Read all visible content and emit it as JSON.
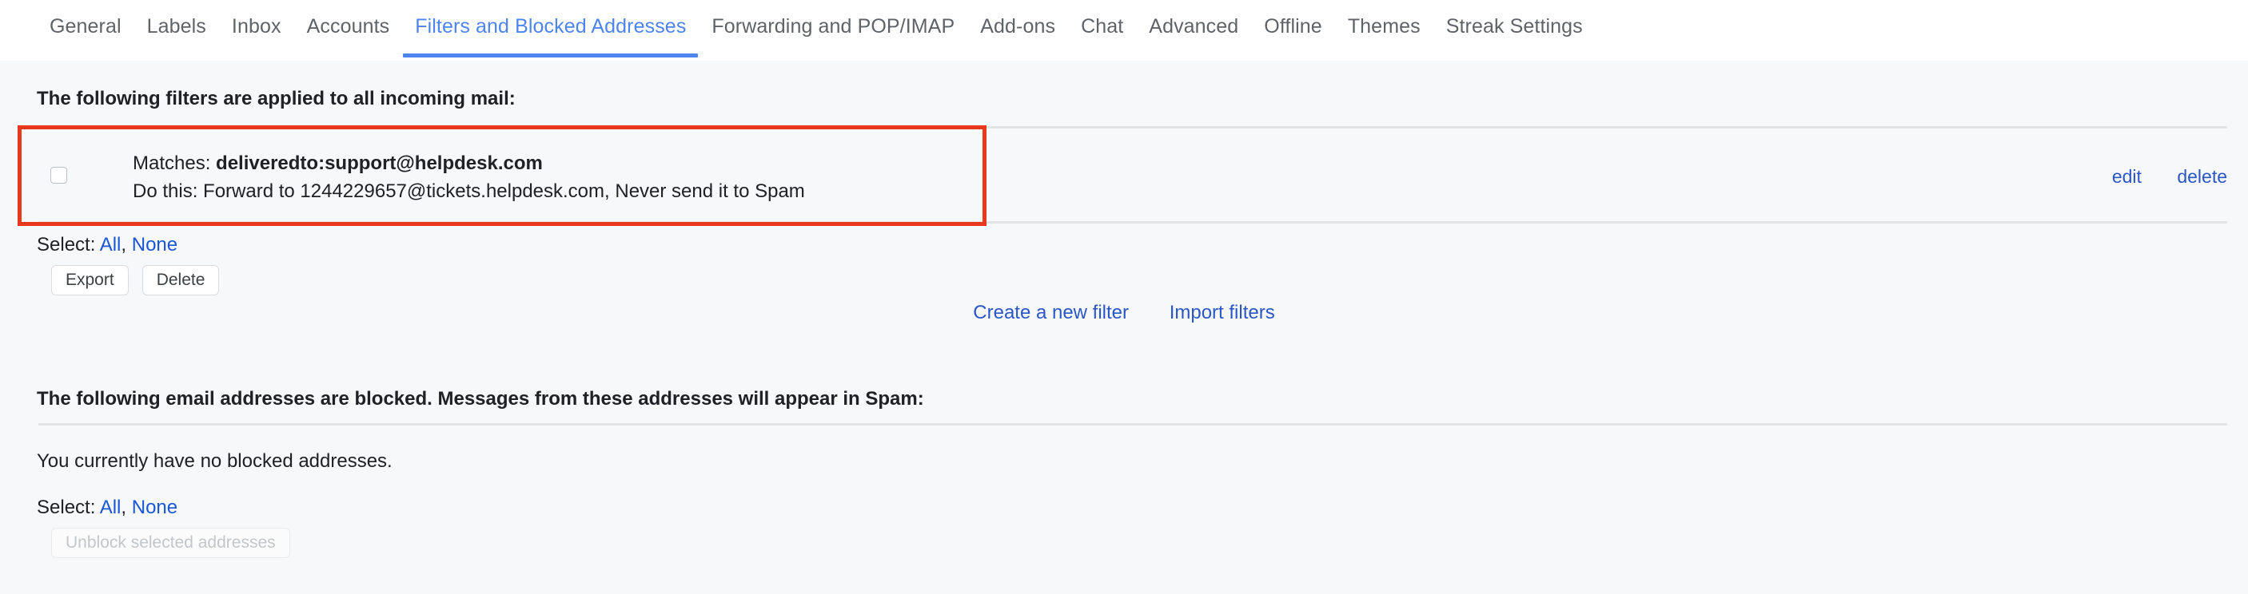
{
  "tabs": [
    {
      "label": "General",
      "active": false
    },
    {
      "label": "Labels",
      "active": false
    },
    {
      "label": "Inbox",
      "active": false
    },
    {
      "label": "Accounts",
      "active": false
    },
    {
      "label": "Filters and Blocked Addresses",
      "active": true
    },
    {
      "label": "Forwarding and POP/IMAP",
      "active": false
    },
    {
      "label": "Add-ons",
      "active": false
    },
    {
      "label": "Chat",
      "active": false
    },
    {
      "label": "Advanced",
      "active": false
    },
    {
      "label": "Offline",
      "active": false
    },
    {
      "label": "Themes",
      "active": false
    },
    {
      "label": "Streak Settings",
      "active": false
    }
  ],
  "filters": {
    "title": "The following filters are applied to all incoming mail:",
    "rows": [
      {
        "matches_label": "Matches:",
        "matches_value": "deliveredto:support@helpdesk.com",
        "dothis_label": "Do this:",
        "dothis_value": "Forward to 1244229657@tickets.helpdesk.com, Never send it to Spam",
        "edit_label": "edit",
        "delete_label": "delete",
        "checked": false
      }
    ],
    "select_label": "Select:",
    "select_all_label": "All",
    "select_separator": ",",
    "select_none_label": "None",
    "export_label": "Export",
    "delete_label": "Delete",
    "create_filter_label": "Create a new filter",
    "import_filters_label": "Import filters"
  },
  "blocked": {
    "title": "The following email addresses are blocked. Messages from these addresses will appear in Spam:",
    "empty_text": "You currently have no blocked addresses.",
    "select_label": "Select:",
    "select_all_label": "All",
    "select_separator": ",",
    "select_none_label": "None",
    "unblock_label": "Unblock selected addresses"
  },
  "colors": {
    "accent_blue": "#4d84ed",
    "link_blue": "#2a56c6",
    "highlight_red": "#e8391c",
    "page_bg": "#f6f8fa",
    "tabbar_bg": "#ffffff",
    "rule_gray": "#e3e4e6"
  }
}
